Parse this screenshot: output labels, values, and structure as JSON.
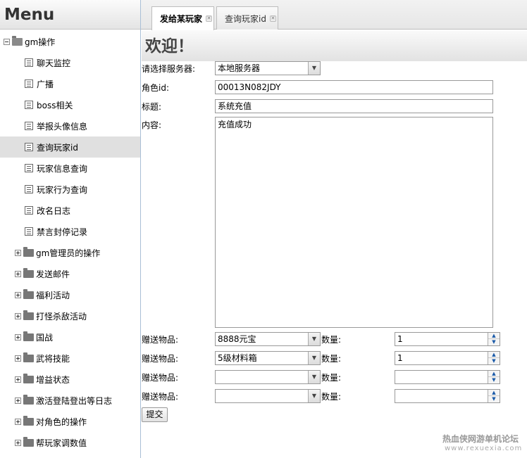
{
  "sidebar": {
    "title": "Menu",
    "root": {
      "label": "gm操作"
    },
    "children": [
      "聊天监控",
      "广播",
      "boss相关",
      "举报头像信息",
      "查询玩家id",
      "玩家信息查询",
      "玩家行为查询",
      "改名日志",
      "禁言封停记录"
    ],
    "selected": "查询玩家id",
    "groups": [
      "gm管理员的操作",
      "发送邮件",
      "福利活动",
      "打怪杀敌活动",
      "国战",
      "武将技能",
      "增益状态",
      "激活登陆登出等日志",
      "对角色的操作",
      "帮玩家调数值"
    ]
  },
  "tabs": [
    {
      "label": "发给某玩家",
      "active": true
    },
    {
      "label": "查询玩家id",
      "active": false
    }
  ],
  "form": {
    "heading": "欢迎！",
    "server_label": "请选择服务器:",
    "server_value": "本地服务器",
    "role_label": "角色id:",
    "role_value": "00013N082JDY",
    "title_label": "标题:",
    "title_value": "系统充值",
    "content_label": "内容:",
    "content_value": "充值成功",
    "gift_label": "赠送物品:",
    "qty_label": "数量:",
    "gifts": [
      {
        "item": "8888元宝",
        "qty": "1"
      },
      {
        "item": "5级材料箱",
        "qty": "1"
      },
      {
        "item": "",
        "qty": ""
      },
      {
        "item": "",
        "qty": ""
      }
    ],
    "submit_label": "提交"
  },
  "watermark": {
    "text": "热血侠网游单机论坛",
    "url": "www.rexuexia.com"
  }
}
